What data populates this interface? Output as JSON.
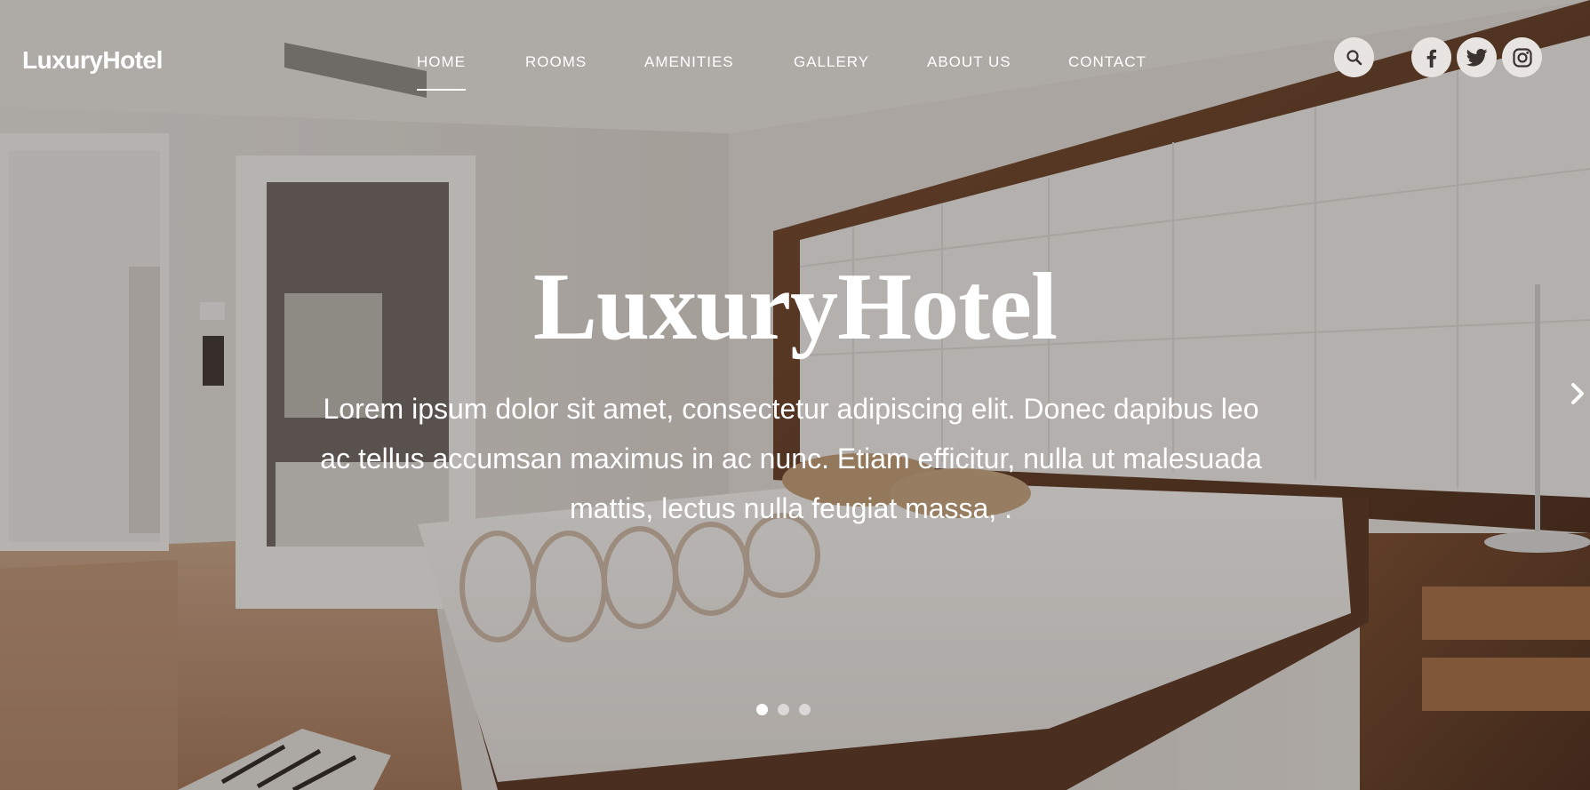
{
  "brand": {
    "logo": "LuxuryHotel"
  },
  "nav": {
    "items": [
      {
        "label": "HOME",
        "active": true
      },
      {
        "label": "ROOMS",
        "active": false
      },
      {
        "label": "AMENITIES",
        "active": false
      },
      {
        "label": "GALLERY",
        "active": false
      },
      {
        "label": "ABOUT US",
        "active": false
      },
      {
        "label": "CONTACT",
        "active": false
      }
    ]
  },
  "header_icons": {
    "search": "search-icon",
    "social": [
      "facebook-icon",
      "twitter-icon",
      "instagram-icon"
    ]
  },
  "hero": {
    "title": "LuxuryHotel",
    "line1": "Lorem ipsum dolor sit amet, consectetur adipiscing elit. Donec dapibus leo",
    "line2": "ac tellus accumsan maximus in ac nunc. Etiam efficitur, nulla ut malesuada",
    "line3": "mattis, lectus nulla feugiat massa, .",
    "next_icon": "chevron-right-icon"
  },
  "slider": {
    "slide_count": 3,
    "active_index": 0
  },
  "colors": {
    "text": "#ffffff",
    "icon_bg": "#e8e4e2",
    "icon_fg": "#3a3330"
  }
}
